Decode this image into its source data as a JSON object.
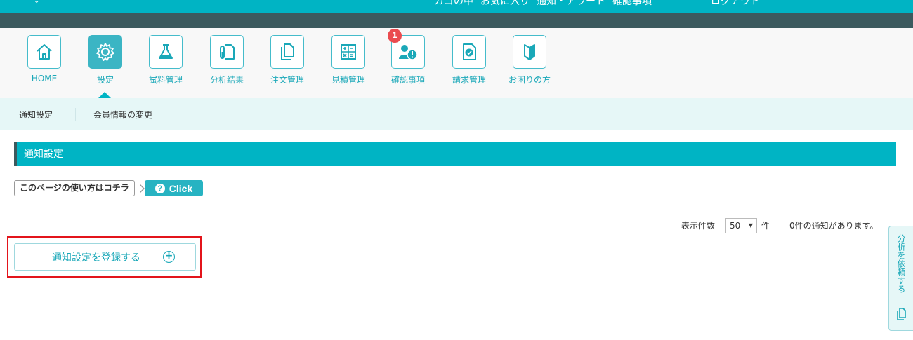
{
  "topbar": {
    "links": [
      "カゴの中",
      "お気に入り",
      "通知・アラート",
      "確認事項"
    ],
    "logout": "ログアウト"
  },
  "nav": {
    "items": [
      {
        "label": "HOME",
        "icon": "home-icon"
      },
      {
        "label": "設定",
        "icon": "gear-icon",
        "active": true
      },
      {
        "label": "試料管理",
        "icon": "flask-icon"
      },
      {
        "label": "分析結果",
        "icon": "test-tube-document-icon"
      },
      {
        "label": "注文管理",
        "icon": "copy-documents-icon"
      },
      {
        "label": "見積管理",
        "icon": "calculator-icon"
      },
      {
        "label": "確認事項",
        "icon": "user-alert-icon",
        "badge": "1"
      },
      {
        "label": "請求管理",
        "icon": "invoice-check-icon"
      },
      {
        "label": "お困りの方",
        "icon": "beginner-mark-icon"
      }
    ]
  },
  "subnav": {
    "items": [
      "通知設定",
      "会員情報の変更"
    ]
  },
  "section": {
    "title": "通知設定"
  },
  "help": {
    "label": "このページの使い方はコチラ",
    "button": "Click"
  },
  "list": {
    "count_label": "表示件数",
    "per_page": "50",
    "unit": "件",
    "message": "0件の通知があります。"
  },
  "register": {
    "label": "通知設定を登録する"
  },
  "side_tab": {
    "label": "分析を依頼する"
  },
  "colors": {
    "primary": "#00b4c4",
    "dark_band": "#3c5a5e",
    "badge": "#ea4b4f",
    "highlight_frame": "#e3141b"
  }
}
